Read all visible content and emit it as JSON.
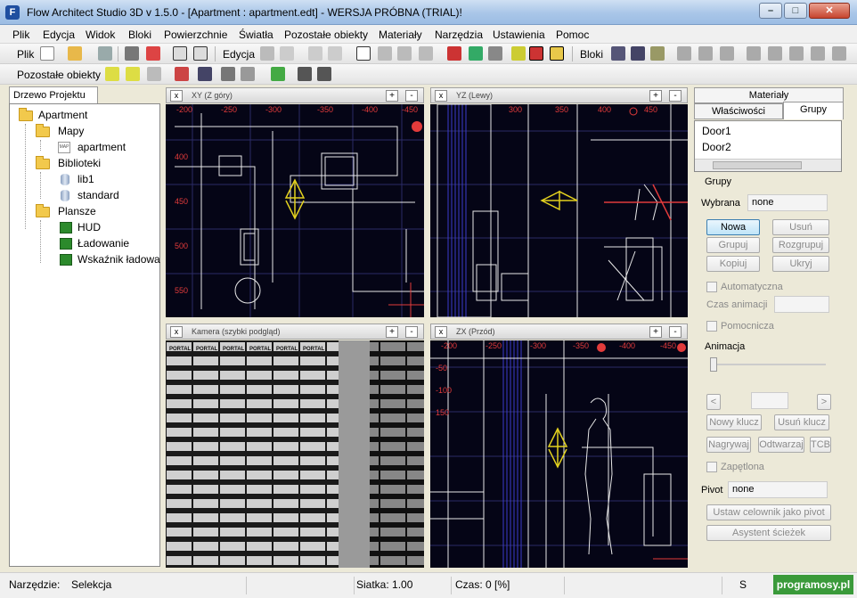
{
  "window": {
    "title": "Flow Architect Studio 3D v 1.5.0  - [Apartment : apartment.edt]  - WERSJA PRÓBNA (TRIAL)!",
    "app_icon_letter": "F",
    "minimize": "–",
    "maximize": "□",
    "close": "✕"
  },
  "menu": [
    "Plik",
    "Edycja",
    "Widok",
    "Bloki",
    "Powierzchnie",
    "Światła",
    "Pozostałe obiekty",
    "Materiały",
    "Narzędzia",
    "Ustawienia",
    "Pomoc"
  ],
  "toolbar": {
    "plik_label": "Plik",
    "edycja_label": "Edycja",
    "bloki_label": "Bloki",
    "pozostale_label": "Pozostałe obiekty"
  },
  "tree": {
    "tab": "Drzewo Projektu",
    "root": "Apartment",
    "maps_folder": "Mapy",
    "map_item": "apartment",
    "map_icon_text": "MAP",
    "libs_folder": "Biblioteki",
    "lib1": "lib1",
    "standard": "standard",
    "boards_folder": "Plansze",
    "hud": "HUD",
    "loading": "Ładowanie",
    "indicator": "Wskaźnik ładowa"
  },
  "viewports": {
    "close": "x",
    "plus": "+",
    "minus": "-",
    "xy": {
      "title": "XY (Z góry)",
      "top_labels": [
        "-200",
        "-250",
        "-300",
        "-350",
        "-400",
        "-450"
      ],
      "left_labels": [
        "400",
        "450",
        "500",
        "550"
      ]
    },
    "yz": {
      "title": "YZ (Lewy)",
      "top_labels": [
        "300",
        "350",
        "400",
        "450"
      ]
    },
    "camera": {
      "title": "Kamera (szybki podgląd)",
      "texture_text": "PORTAL"
    },
    "zx": {
      "title": "ZX (Przód)",
      "top_labels": [
        "-200",
        "-250",
        "-300",
        "-350",
        "-400",
        "-450"
      ],
      "left_labels": [
        "-50",
        "-100",
        "150"
      ]
    }
  },
  "right_panel": {
    "tab_materials": "Materiały",
    "tab_properties": "Właściwości",
    "tab_groups": "Grupy",
    "group_items": [
      "Door1",
      "Door2"
    ],
    "groups_section": "Grupy",
    "selected_label": "Wybrana",
    "selected_value": "none",
    "btn_new": "Nowa",
    "btn_delete": "Usuń",
    "btn_group": "Grupuj",
    "btn_ungroup": "Rozgrupuj",
    "btn_copy": "Kopiuj",
    "btn_hide": "Ukryj",
    "auto_label": "Automatyczna",
    "anim_time_label": "Czas animacji",
    "helper_label": "Pomocnicza",
    "animation_section": "Animacja",
    "prev": "<",
    "next": ">",
    "btn_new_key": "Nowy klucz",
    "btn_del_key": "Usuń klucz",
    "btn_record": "Nagrywaj",
    "btn_play": "Odtwarzaj",
    "btn_tcb": "TCB",
    "loop_label": "Zapętlona",
    "pivot_label": "Pivot",
    "pivot_value": "none",
    "btn_set_pivot": "Ustaw celownik jako pivot",
    "btn_path_assistant": "Asystent ścieżek"
  },
  "status": {
    "tool_label": "Narzędzie:",
    "tool_value": "Selekcja",
    "grid": "Siatka: 1.00",
    "time": "Czas: 0 [%]",
    "s": "S",
    "brand": "programosy.pl"
  }
}
